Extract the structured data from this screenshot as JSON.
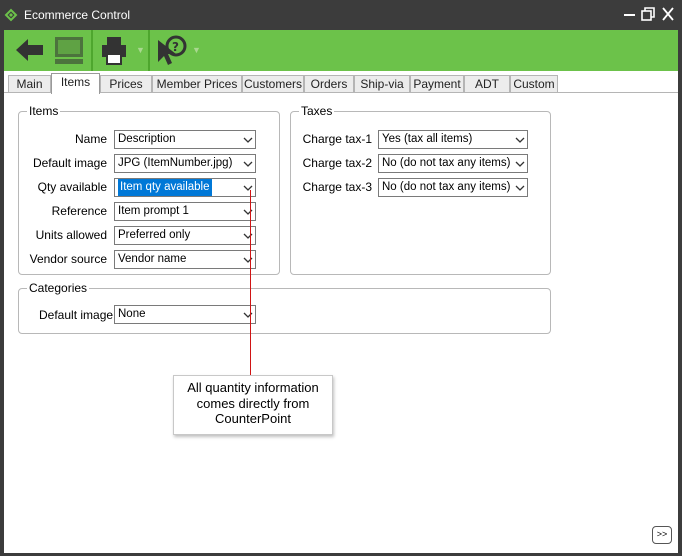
{
  "window": {
    "title": "Ecommerce Control"
  },
  "toolbar": {
    "buttons": [
      "back-arrow-icon",
      "save-icon",
      "print-icon",
      "help-pointer-icon"
    ],
    "accent_color": "#6cc24a"
  },
  "tabs": [
    {
      "label": "Main"
    },
    {
      "label": "Items",
      "active": true
    },
    {
      "label": "Prices"
    },
    {
      "label": "Member Prices"
    },
    {
      "label": "Customers"
    },
    {
      "label": "Orders"
    },
    {
      "label": "Ship-via"
    },
    {
      "label": "Payment"
    },
    {
      "label": "ADT"
    },
    {
      "label": "Custom"
    }
  ],
  "items_group": {
    "title": "Items",
    "rows": [
      {
        "label": "Name",
        "value": "Description"
      },
      {
        "label": "Default image",
        "value": "JPG (ItemNumber.jpg)"
      },
      {
        "label": "Qty available",
        "value": "Item qty available"
      },
      {
        "label": "Reference",
        "value": "Item prompt 1"
      },
      {
        "label": "Units allowed",
        "value": "Preferred only"
      },
      {
        "label": "Vendor source",
        "value": "Vendor name"
      }
    ]
  },
  "taxes_group": {
    "title": "Taxes",
    "rows": [
      {
        "label": "Charge tax-1",
        "value": "Yes (tax all items)"
      },
      {
        "label": "Charge tax-2",
        "value": "No (do not tax any items)"
      },
      {
        "label": "Charge tax-3",
        "value": "No (do not tax any items)"
      }
    ]
  },
  "categories_group": {
    "title": "Categories",
    "rows": [
      {
        "label": "Default image",
        "value": "None"
      }
    ]
  },
  "callout": {
    "text": "All quantity information comes directly from CounterPoint",
    "line_color": "#d01414"
  },
  "more_button": {
    "label": ">>"
  }
}
